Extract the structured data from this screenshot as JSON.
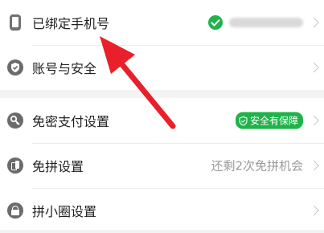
{
  "settings": {
    "group1": [
      {
        "label": "已绑定手机号"
      },
      {
        "label": "账号与安全"
      }
    ],
    "group2": [
      {
        "label": "免密支付设置",
        "badge": "安全有保障"
      },
      {
        "label": "免拼设置",
        "value": "还剩2次免拼机会"
      },
      {
        "label": "拼小圈设置"
      }
    ]
  },
  "colors": {
    "accent_green": "#1fb34a",
    "arrow_red": "#e8202a"
  }
}
